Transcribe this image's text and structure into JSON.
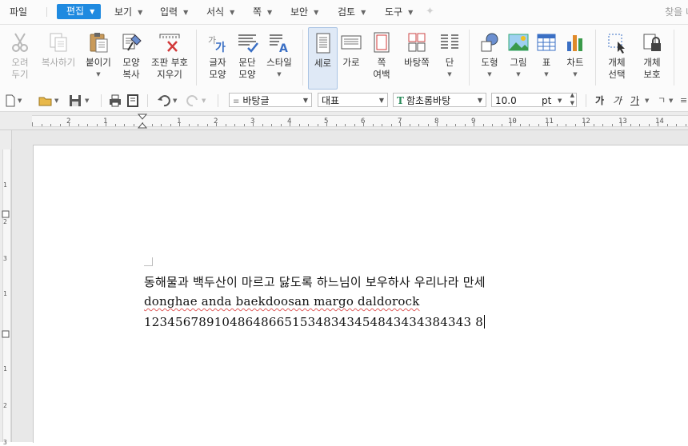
{
  "menu": {
    "file": "파일",
    "items": [
      "편집",
      "보기",
      "입력",
      "서식",
      "쪽",
      "보안",
      "검토",
      "도구"
    ],
    "active": "편집",
    "search_hint": "찾을 내"
  },
  "ribbon": {
    "cut": [
      "오려",
      "두기"
    ],
    "copy": "복사하기",
    "paste": "붙이기",
    "format_painter": [
      "모양",
      "복사"
    ],
    "clear_field": [
      "조판 부호",
      "지우기"
    ],
    "char_shape": [
      "글자",
      "모양"
    ],
    "para_shape": [
      "문단",
      "모양"
    ],
    "style": "스타일",
    "portrait": "세로",
    "landscape": "가로",
    "page_margin": [
      "쪽",
      "여백"
    ],
    "page_background": "바탕쪽",
    "columns": "단",
    "shape": "도형",
    "picture": "그림",
    "table": "표",
    "chart": "차트",
    "object_select": [
      "개체",
      "선택"
    ],
    "object_protect": [
      "개체",
      "보호"
    ]
  },
  "toolbar": {
    "style_value": "바탕글",
    "lang_value": "대표",
    "font_value": "함초롬바탕",
    "font_badge": "T",
    "size_value": "10.0",
    "size_unit": "pt",
    "bold": "가",
    "italic": "가",
    "underline": "가"
  },
  "ruler": {
    "h_numbers": [
      "2",
      "1",
      "1",
      "2",
      "3",
      "4",
      "5",
      "6",
      "7",
      "8",
      "9",
      "10",
      "11",
      "12",
      "13",
      "14"
    ],
    "v_numbers": [
      "1",
      "2",
      "3",
      "1",
      "1",
      "2",
      "3"
    ],
    "corner_glyph": "L"
  },
  "document": {
    "lines": [
      "동해물과 백두산이 마르고 닳도록 하느님이 보우하사 우리나라 만세",
      "donghae anda baekdoosan margo daldorock",
      "12345678910486486651534834345484343438434 38"
    ],
    "line3": "123456789104864866515348343454843434384343 8"
  },
  "colors": {
    "accent": "#1f8ae0",
    "selected_bg": "#dfe9f6"
  }
}
